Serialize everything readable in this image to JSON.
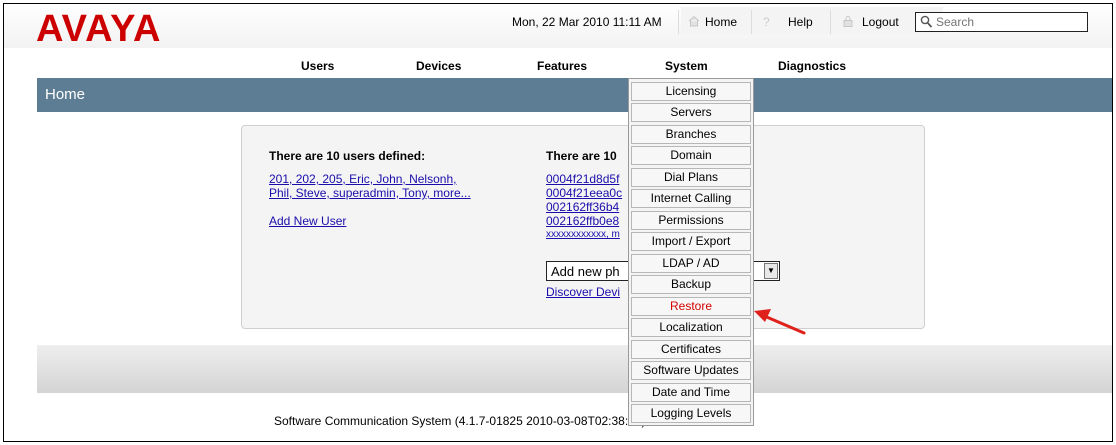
{
  "brand": {
    "logo_text": "AVAYA",
    "logo_color": "#cc0000"
  },
  "header": {
    "date_time": "Mon, 22 Mar 2010 11:11 AM",
    "home_label": "Home",
    "help_label": "Help",
    "logout_label": "Logout",
    "search_placeholder": "Search"
  },
  "nav": {
    "items": [
      {
        "label": "Users"
      },
      {
        "label": "Devices"
      },
      {
        "label": "Features"
      },
      {
        "label": "System"
      },
      {
        "label": "Diagnostics"
      }
    ]
  },
  "page": {
    "title": "Home",
    "title_bar_color": "#5d7d94"
  },
  "users_section": {
    "heading": "There are 10 users defined:",
    "list_line1": "201, 202, 205, Eric, John, Nelsonh,",
    "list_line2": "Phil, Steve, superadmin, Tony, more...",
    "add_link": "Add New User"
  },
  "devices_section": {
    "heading": "There are 10",
    "devices": [
      {
        "id": "0004f21d8d5f"
      },
      {
        "id": "0004f21eea0c"
      },
      {
        "id": "002162ff36b4"
      },
      {
        "id": "002162ffb0e8"
      },
      {
        "id": "xxxxxxxxxxxx, m"
      }
    ],
    "add_select_value": "Add new ph",
    "discover_link": "Discover Devi"
  },
  "system_menu": {
    "items": [
      {
        "label": "Licensing"
      },
      {
        "label": "Servers"
      },
      {
        "label": "Branches"
      },
      {
        "label": "Domain"
      },
      {
        "label": "Dial Plans"
      },
      {
        "label": "Internet Calling"
      },
      {
        "label": "Permissions"
      },
      {
        "label": "Import / Export"
      },
      {
        "label": "LDAP / AD"
      },
      {
        "label": "Backup"
      },
      {
        "label": "Restore"
      },
      {
        "label": "Localization"
      },
      {
        "label": "Certificates"
      },
      {
        "label": "Software Updates"
      },
      {
        "label": "Date and Time"
      },
      {
        "label": "Logging Levels"
      }
    ],
    "highlight_color": "#d40000",
    "annotation_arrow_color": "#e0201b"
  },
  "footer": {
    "text": "Software Communication System (4.1.7-01825 2010-03-08T02:38:54)"
  },
  "icons": {
    "home": "house-icon",
    "help": "question-icon",
    "logout": "padlock-icon",
    "search": "magnifier-icon"
  }
}
